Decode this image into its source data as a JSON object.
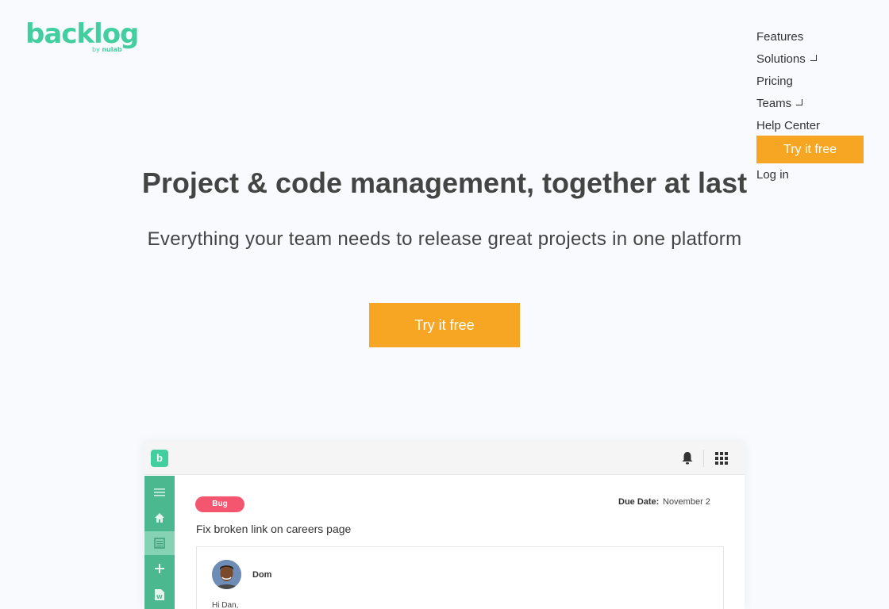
{
  "logo": {
    "word": "backlog",
    "by": "by",
    "brand": "nulab"
  },
  "nav": {
    "items": [
      {
        "label": "Features",
        "has_submenu": false
      },
      {
        "label": "Solutions",
        "has_submenu": true
      },
      {
        "label": "Pricing",
        "has_submenu": false
      },
      {
        "label": "Teams",
        "has_submenu": true
      },
      {
        "label": "Help Center",
        "has_submenu": false
      }
    ],
    "cta": "Try it free",
    "login": "Log in"
  },
  "hero": {
    "title": "Project & code management, together at last",
    "subtitle": "Everything your team needs to release great projects in one platform",
    "cta": "Try it free"
  },
  "mockup": {
    "app_logo_letter": "b",
    "issue": {
      "type": "Bug",
      "due_label": "Due Date:",
      "due_value": "November 2",
      "title": "Fix broken link on careers page"
    },
    "comment": {
      "author": "Dom",
      "text": "Hi Dan,"
    },
    "sidebar_icons": [
      "menu-icon",
      "home-icon",
      "list-icon",
      "plus-icon",
      "document-icon"
    ]
  },
  "colors": {
    "brand_green": "#42ce9f",
    "cta_orange": "#f6a623",
    "bug_red": "#f4566f",
    "sidebar_green": "#4cb890"
  }
}
